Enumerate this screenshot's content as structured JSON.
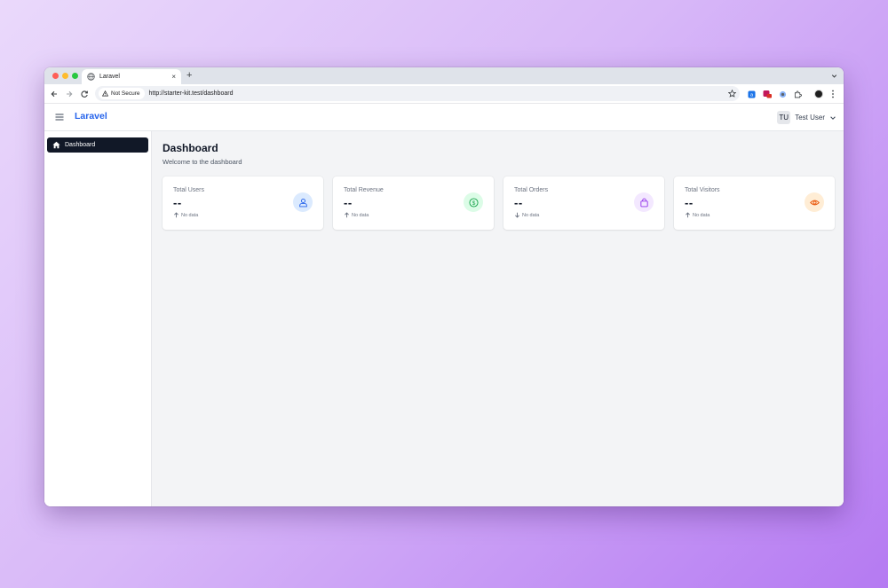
{
  "browser": {
    "tab_title": "Laravel",
    "tab_close": "×",
    "new_tab": "+",
    "security_label": "Not Secure",
    "url": "http://starter-kit.test/dashboard"
  },
  "header": {
    "brand": "Laravel",
    "user_initials": "TU",
    "user_name": "Test User"
  },
  "sidebar": {
    "items": [
      {
        "label": "Dashboard",
        "icon": "home-icon",
        "active": true
      }
    ]
  },
  "main": {
    "title": "Dashboard",
    "subtitle": "Welcome to the dashboard",
    "cards": [
      {
        "label": "Total Users",
        "value": "--",
        "trend": "No data",
        "trend_direction": "up",
        "icon": "users-icon",
        "icon_bg": "#dbeafe",
        "icon_color": "#2563eb"
      },
      {
        "label": "Total Revenue",
        "value": "--",
        "trend": "No data",
        "trend_direction": "up",
        "icon": "dollar-icon",
        "icon_bg": "#dcfce7",
        "icon_color": "#16a34a"
      },
      {
        "label": "Total Orders",
        "value": "--",
        "trend": "No data",
        "trend_direction": "down",
        "icon": "shopping-bag-icon",
        "icon_bg": "#f3e8ff",
        "icon_color": "#9333ea"
      },
      {
        "label": "Total Visitors",
        "value": "--",
        "trend": "No data",
        "trend_direction": "up",
        "icon": "eye-icon",
        "icon_bg": "#ffedd5",
        "icon_color": "#ea580c"
      }
    ]
  },
  "colors": {
    "brand": "#2563eb",
    "sidebar_active_bg": "#111827"
  }
}
